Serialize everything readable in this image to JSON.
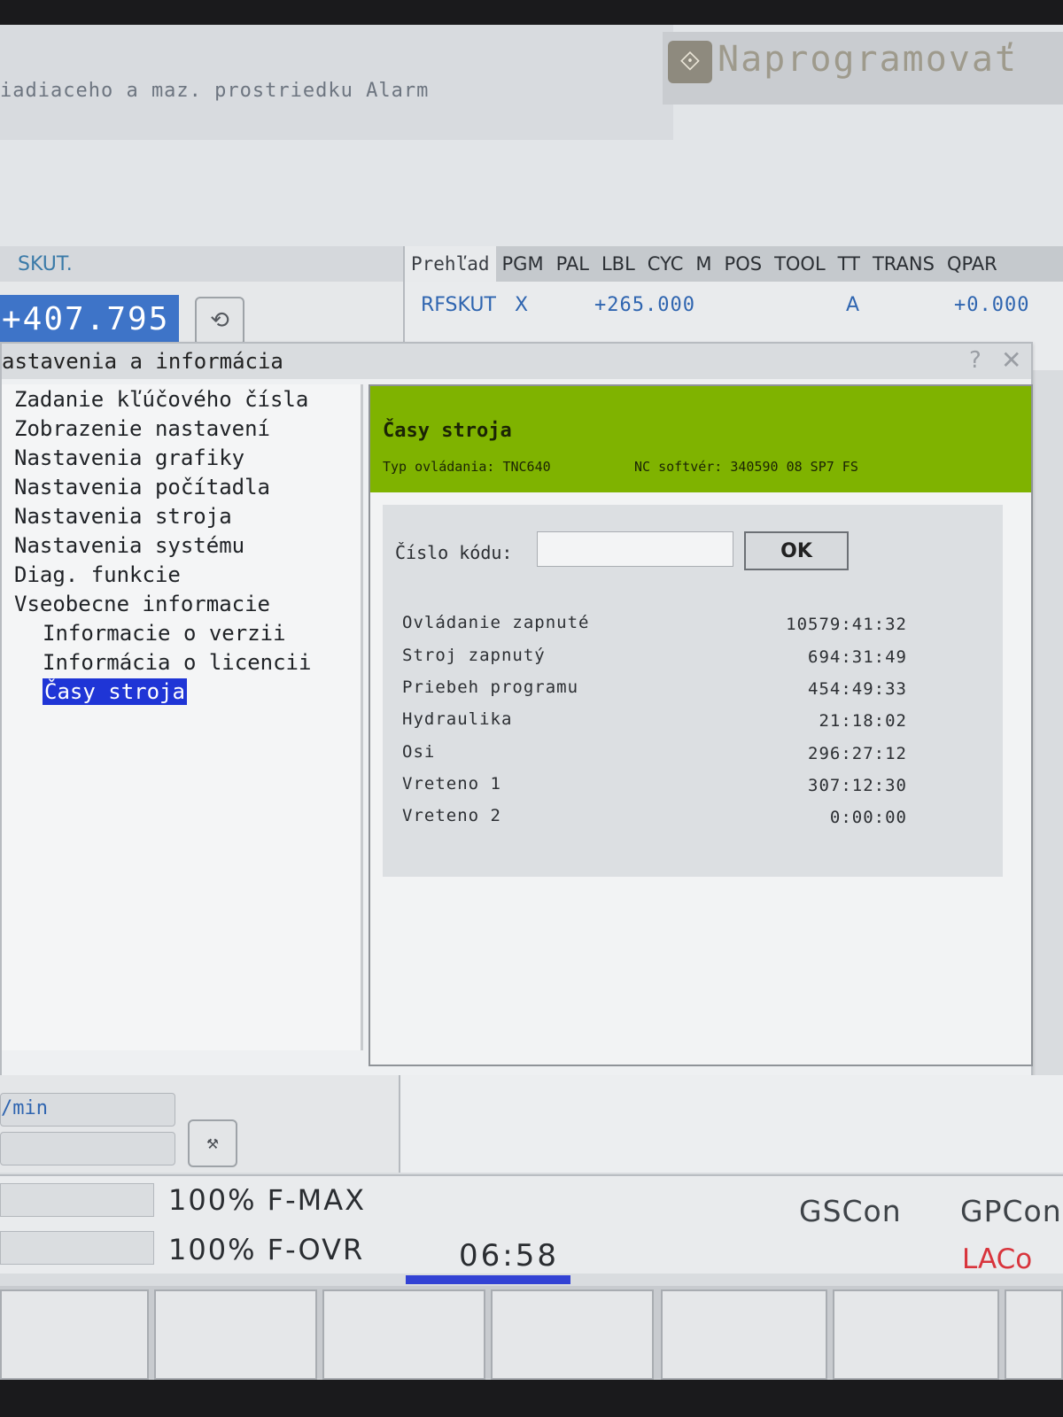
{
  "header": {
    "alarm_text": "iadiaceho a maz. prostriedku Alarm",
    "mode_label": "Naprogramovať",
    "mode_icon": "program-arrow-icon"
  },
  "position_panel": {
    "label": "SKUT.",
    "value": "+407.795",
    "refresh_icon": "refresh-icon"
  },
  "status_tabs": {
    "tabs": [
      "Prehľad",
      "PGM",
      "PAL",
      "LBL",
      "CYC",
      "M",
      "POS",
      "TOOL",
      "TT",
      "TRANS",
      "QPAR"
    ],
    "row": {
      "label": "RFSKUT",
      "axis1": "X",
      "value1": "+265.000",
      "axis2": "A",
      "value2": "+0.000"
    }
  },
  "dialog": {
    "title": "astavenia a informácia",
    "help": "?",
    "close": "✕",
    "menu": [
      {
        "label": "Zadanie kľúčového čísla",
        "level": "top"
      },
      {
        "label": "Zobrazenie nastavení",
        "level": "top"
      },
      {
        "label": "Nastavenia grafiky",
        "level": "top"
      },
      {
        "label": "Nastavenia počítadla",
        "level": "top"
      },
      {
        "label": "Nastavenia stroja",
        "level": "top"
      },
      {
        "label": "Nastavenia systému",
        "level": "top"
      },
      {
        "label": "Diag. funkcie",
        "level": "top"
      },
      {
        "label": "Vseobecne informacie",
        "level": "top"
      },
      {
        "label": "Informacie o verzii",
        "level": "sub"
      },
      {
        "label": "Informácia o licencii",
        "level": "sub"
      },
      {
        "label": "Časy stroja",
        "level": "sub",
        "selected": true
      }
    ],
    "panel": {
      "title": "Časy stroja",
      "control_type": "Typ ovládania: TNC640",
      "nc_software": "NC softvér: 340590 08 SP7 FS",
      "code_label": "Číslo kódu:",
      "code_value": "",
      "ok_label": "OK",
      "times": [
        {
          "label": "Ovládanie zapnuté",
          "value": "10579:41:32"
        },
        {
          "label": "Stroj zapnutý",
          "value": "694:31:49"
        },
        {
          "label": "Priebeh programu",
          "value": "454:49:33"
        },
        {
          "label": "Hydraulika",
          "value": "21:18:02"
        },
        {
          "label": "Osi",
          "value": "296:27:12"
        },
        {
          "label": "Vreteno 1",
          "value": "307:12:30"
        },
        {
          "label": "Vreteno 2",
          "value": "0:00:00"
        }
      ]
    }
  },
  "feed": {
    "unit": "/min",
    "tool_icon": "tool-call-icon"
  },
  "status": {
    "fmax": "100% F-MAX",
    "fovr": "100% F-OVR",
    "clock": "06:58",
    "gscon": "GSCon",
    "gpcon": "GPCon",
    "laco": "LACo",
    "accent_red": "#d8343c",
    "accent_green": "#7fb300",
    "selection_blue": "#1f35d6"
  }
}
